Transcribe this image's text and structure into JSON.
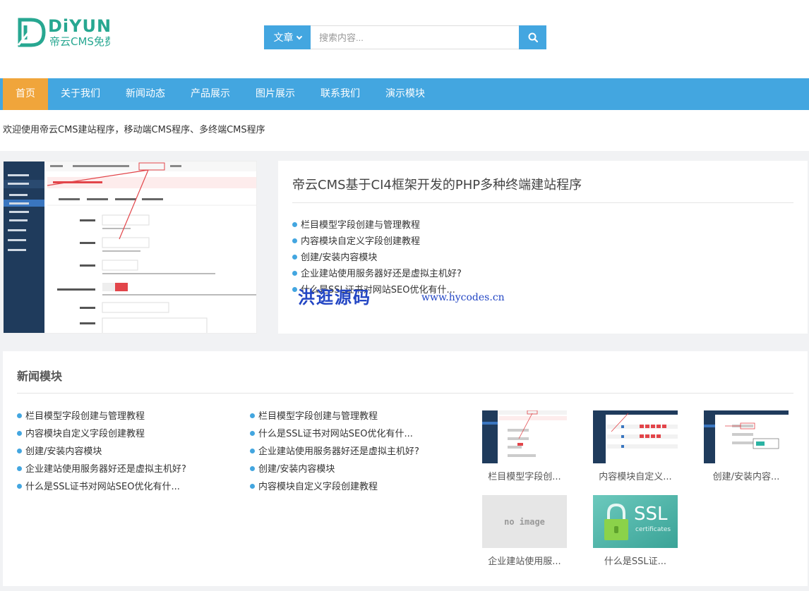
{
  "logo": {
    "text_en": "DiYUN",
    "text_cn": "帝云CMS免费"
  },
  "search": {
    "type_label": "文章",
    "placeholder": "搜索内容..."
  },
  "nav": [
    "首页",
    "关于我们",
    "新闻动态",
    "产品展示",
    "图片展示",
    "联系我们",
    "演示模块"
  ],
  "welcome": "欢迎使用帝云CMS建站程序，移动端CMS程序、多终端CMS程序",
  "feature": {
    "title": "帝云CMS基于CI4框架开发的PHP多种终端建站程序",
    "items": [
      "栏目模型字段创建与管理教程",
      "内容模块自定义字段创建教程",
      "创建/安装内容模块",
      "企业建站使用服务器好还是虚拟主机好?",
      "什么是SSL证书对网站SEO优化有什..."
    ]
  },
  "watermark": {
    "cn": "洪逛源码",
    "url": "www.hycodes.cn"
  },
  "news": {
    "title": "新闻模块",
    "col1": [
      "栏目模型字段创建与管理教程",
      "内容模块自定义字段创建教程",
      "创建/安装内容模块",
      "企业建站使用服务器好还是虚拟主机好?",
      "什么是SSL证书对网站SEO优化有什..."
    ],
    "col2": [
      "栏目模型字段创建与管理教程",
      "什么是SSL证书对网站SEO优化有什...",
      "企业建站使用服务器好还是虚拟主机好?",
      "创建/安装内容模块",
      "内容模块自定义字段创建教程"
    ],
    "thumbs": [
      "栏目模型字段创...",
      "内容模块自定义...",
      "创建/安装内容...",
      "企业建站使用服...",
      "什么是SSL证..."
    ],
    "no_image": "no image",
    "ssl": {
      "main": "SSL",
      "sub": "certificates"
    }
  },
  "colors": {
    "primary": "#43a6e0",
    "active": "#f0a53b",
    "logo": "#27a791"
  }
}
